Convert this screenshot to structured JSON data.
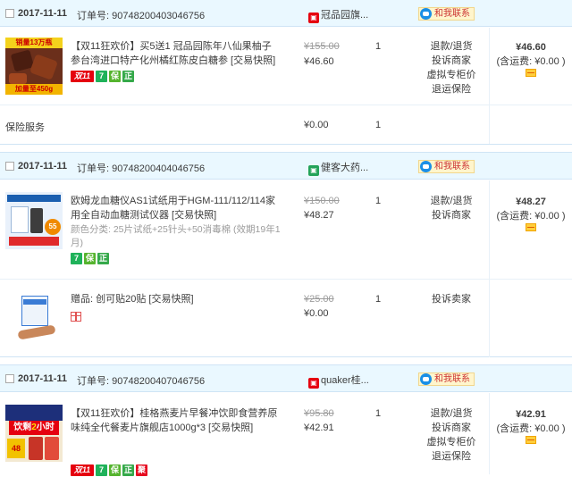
{
  "orders": [
    {
      "date": "2017-11-11",
      "order_label": "订单号:",
      "order_no": "90748200403046756",
      "shop": "冠品园旗...",
      "contact": "和我联系",
      "items": [
        {
          "title": "【双11狂欢价】买5送1 冠品园陈年八仙果柚子参台湾进口特产化州橘红陈皮白糖参 [交易快照]",
          "price_old": "¥155.00",
          "price_now": "¥46.60",
          "qty": "1",
          "ops": [
            "退款/退货",
            "投诉商家",
            "虚拟专柜价",
            "退运保险"
          ],
          "tags": [
            "双11",
            "7",
            "保",
            "正"
          ]
        }
      ],
      "service": {
        "label": "保险服务",
        "price": "¥0.00",
        "qty": "1"
      },
      "total": "¥46.60",
      "freight": "(含运费: ¥0.00 )"
    },
    {
      "date": "2017-11-11",
      "order_label": "订单号:",
      "order_no": "90748200404046756",
      "shop": "健客大药...",
      "contact": "和我联系",
      "items": [
        {
          "title": "欧姆龙血糖仪AS1试纸用于HGM-111/112/114家用全自动血糖测试仪器 [交易快照]",
          "sku": "颜色分类: 25片试纸+25针头+50消毒棉 (效期19年1月)",
          "price_old": "¥150.00",
          "price_now": "¥48.27",
          "qty": "1",
          "ops": [
            "退款/退货",
            "投诉商家"
          ],
          "tags": [
            "7",
            "保",
            "正"
          ]
        },
        {
          "title": "赠品: 创可贴20贴 [交易快照]",
          "price_old": "¥25.00",
          "price_now": "¥0.00",
          "qty": "1",
          "ops": [
            "投诉卖家"
          ]
        }
      ],
      "total": "¥48.27",
      "freight": "(含运费: ¥0.00 )"
    },
    {
      "date": "2017-11-11",
      "order_label": "订单号:",
      "order_no": "90748200407046756",
      "shop": "quaker桂...",
      "contact": "和我联系",
      "items": [
        {
          "title": "【双11狂欢价】桂格燕麦片早餐冲饮即食营养原味纯全代餐麦片旗舰店1000g*3 [交易快照]",
          "price_old": "¥95.80",
          "price_now": "¥42.91",
          "qty": "1",
          "ops": [
            "退款/退货",
            "投诉商家",
            "虚拟专柜价",
            "退运保险"
          ],
          "tags": [
            "双11",
            "7",
            "保",
            "正",
            "聚"
          ]
        }
      ],
      "total": "¥42.91",
      "freight": "(含运费: ¥0.00 )"
    }
  ],
  "product_images": {
    "p1_banner": "销量13万瓶",
    "p1_sub": "加量至450g",
    "p2_badge": "55",
    "p3_line1": "饮剩",
    "p3_line2": "2",
    "p3_line3": "小时",
    "p3_price": "48"
  }
}
